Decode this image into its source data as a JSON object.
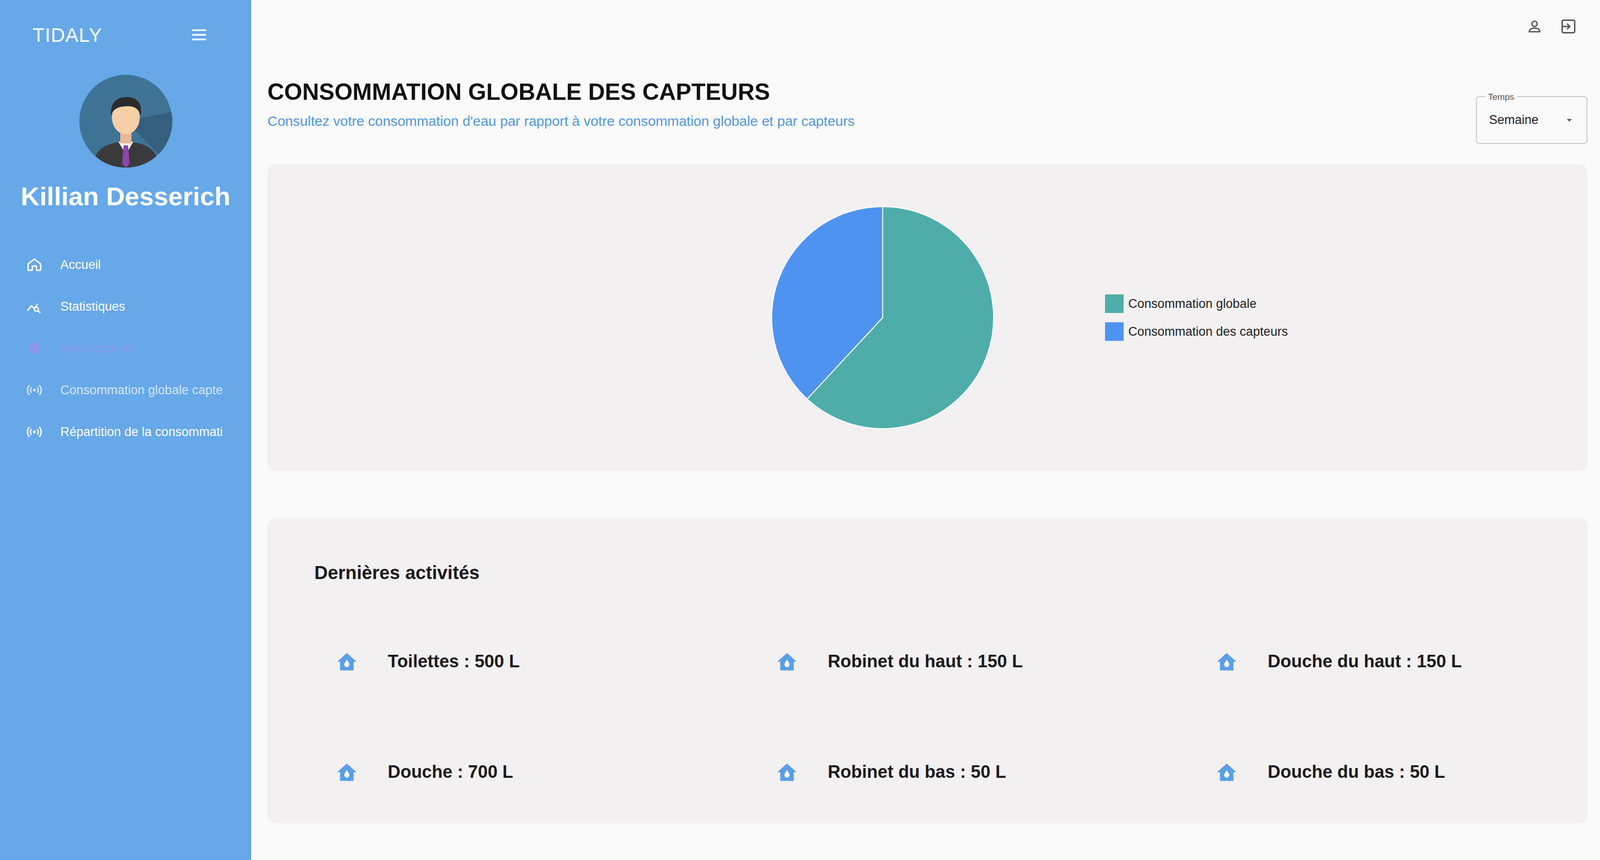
{
  "app": {
    "logo": "TIDALY"
  },
  "user": {
    "name": "Killian Desserich"
  },
  "sidebar": {
    "items": [
      {
        "label": "Accueil",
        "selected": false,
        "disabled": false
      },
      {
        "label": "Statistiques",
        "selected": false,
        "disabled": false
      },
      {
        "label": "Mes capteurs",
        "selected": true,
        "disabled": false
      },
      {
        "label": "Consommation globale capte",
        "selected": false,
        "disabled": true
      },
      {
        "label": "Répartition de la consommati",
        "selected": false,
        "disabled": false
      }
    ]
  },
  "page": {
    "title": "CONSOMMATION GLOBALE DES CAPTEURS",
    "subtitle": "Consultez votre consommation d'eau par rapport à votre consommation globale et par capteurs"
  },
  "time_select": {
    "label": "Temps",
    "value": "Semaine"
  },
  "chart": {
    "series": [
      {
        "label": "Consommation globale",
        "values": [
          2600
        ],
        "color": "#4fada9"
      },
      {
        "label": "Consommation des capteurs",
        "values": [
          1600
        ],
        "color": "#4f93f0"
      }
    ]
  },
  "activities": {
    "title": "Dernières activités",
    "items": [
      "Toilettes : 500 L",
      "Robinet du haut : 150 L",
      "Douche du haut : 150 L",
      "Douche : 700 L",
      "Robinet du bas : 50 L",
      "Douche du bas : 50 L"
    ]
  }
}
